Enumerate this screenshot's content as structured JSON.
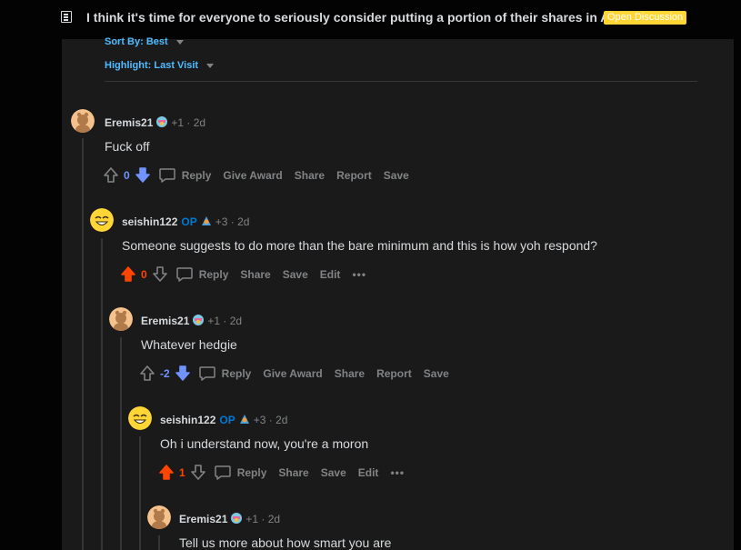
{
  "post": {
    "title": "I think it's time for everyone to seriously consider putting a portion of their shares in AST",
    "flair": "Open Discussion"
  },
  "sort": {
    "sort_label": "Sort By: Best",
    "highlight_label": "Highlight: Last Visit"
  },
  "actions": {
    "reply": "Reply",
    "give_award": "Give Award",
    "share": "Share",
    "report": "Report",
    "save": "Save",
    "edit": "Edit",
    "more": "•••"
  },
  "colors": {
    "upvote": "#ff4500",
    "downvote": "#7193ff",
    "op": "#0079d3",
    "flair": "#ffd635"
  },
  "comments": [
    {
      "user": "Eremis21",
      "op": "",
      "meta": "+1 · 2d",
      "text": "Fuck off",
      "score": "0",
      "vote": "down",
      "own": false
    },
    {
      "user": "seishin122",
      "op": "OP",
      "meta": "+3 · 2d",
      "text": "Someone suggests to do more than the bare minimum and this is how yoh respond?",
      "score": "0",
      "vote": "up",
      "own": true
    },
    {
      "user": "Eremis21",
      "op": "",
      "meta": "+1 · 2d",
      "text": "Whatever hedgie",
      "score": "-2",
      "vote": "down",
      "own": false
    },
    {
      "user": "seishin122",
      "op": "OP",
      "meta": "+3 · 2d",
      "text": "Oh i understand now, you're a moron",
      "score": "1",
      "vote": "up",
      "own": true
    },
    {
      "user": "Eremis21",
      "op": "",
      "meta": "+1 · 2d",
      "text": "Tell us more about how smart you are",
      "score": "",
      "vote": "",
      "own": false
    }
  ]
}
